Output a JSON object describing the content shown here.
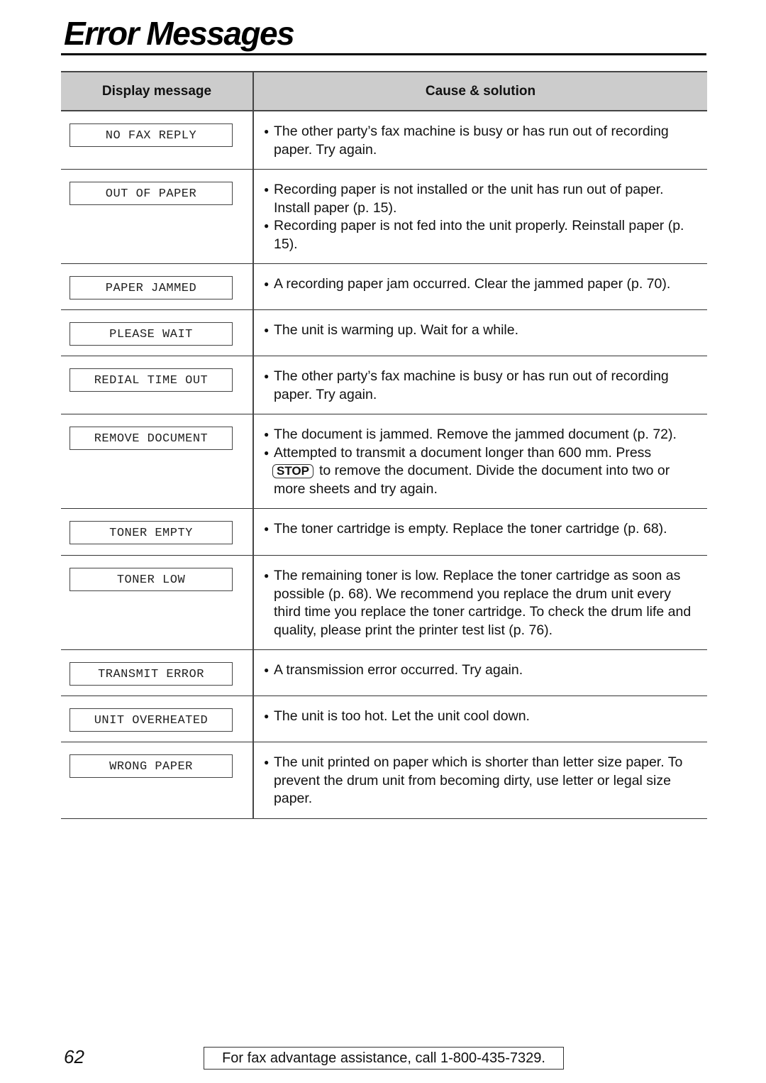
{
  "page": {
    "title": "Error Messages",
    "page_number": "62",
    "footer": "For fax advantage assistance, call 1-800-435-7329."
  },
  "table": {
    "headers": [
      "Display message",
      "Cause & solution"
    ],
    "rows": [
      {
        "message": "NO FAX REPLY",
        "causes": [
          "The other party’s fax machine is busy or has run out of recording paper. Try again."
        ]
      },
      {
        "message": "OUT OF PAPER",
        "causes": [
          "Recording paper is not installed or the unit has run out of paper. Install paper (p. 15).",
          "Recording paper is not fed into the unit properly. Reinstall paper (p. 15)."
        ]
      },
      {
        "message": "PAPER JAMMED",
        "causes": [
          "A recording paper jam occurred. Clear the jammed paper (p. 70)."
        ]
      },
      {
        "message": "PLEASE WAIT",
        "causes": [
          "The unit is warming up. Wait for a while."
        ]
      },
      {
        "message": "REDIAL TIME OUT",
        "causes": [
          "The other party’s fax machine is busy or has run out of recording paper. Try again."
        ]
      },
      {
        "message": "REMOVE DOCUMENT",
        "causes": [
          "The document is jammed. Remove the jammed document (p. 72).",
          "Attempted to transmit a document longer than 600 mm. Press"
        ],
        "key_label": "STOP",
        "after_key": "to remove the document. Divide the document into two or more sheets and try again."
      },
      {
        "message": "TONER EMPTY",
        "causes": [
          "The toner cartridge is empty. Replace the toner cartridge (p. 68)."
        ]
      },
      {
        "message": "TONER LOW",
        "causes": [
          "The remaining toner is low. Replace the toner cartridge as soon as possible (p. 68). We recommend you replace the drum unit every third time you replace the toner cartridge. To check the drum life and quality, please print the printer test list (p. 76)."
        ]
      },
      {
        "message": "TRANSMIT ERROR",
        "causes": [
          "A transmission error occurred. Try again."
        ]
      },
      {
        "message": "UNIT OVERHEATED",
        "causes": [
          "The unit is too hot. Let the unit cool down."
        ]
      },
      {
        "message": "WRONG PAPER",
        "causes": [
          "The unit printed on paper which is shorter than letter size paper. To prevent the drum unit from becoming dirty, use letter or legal size paper."
        ]
      }
    ]
  }
}
